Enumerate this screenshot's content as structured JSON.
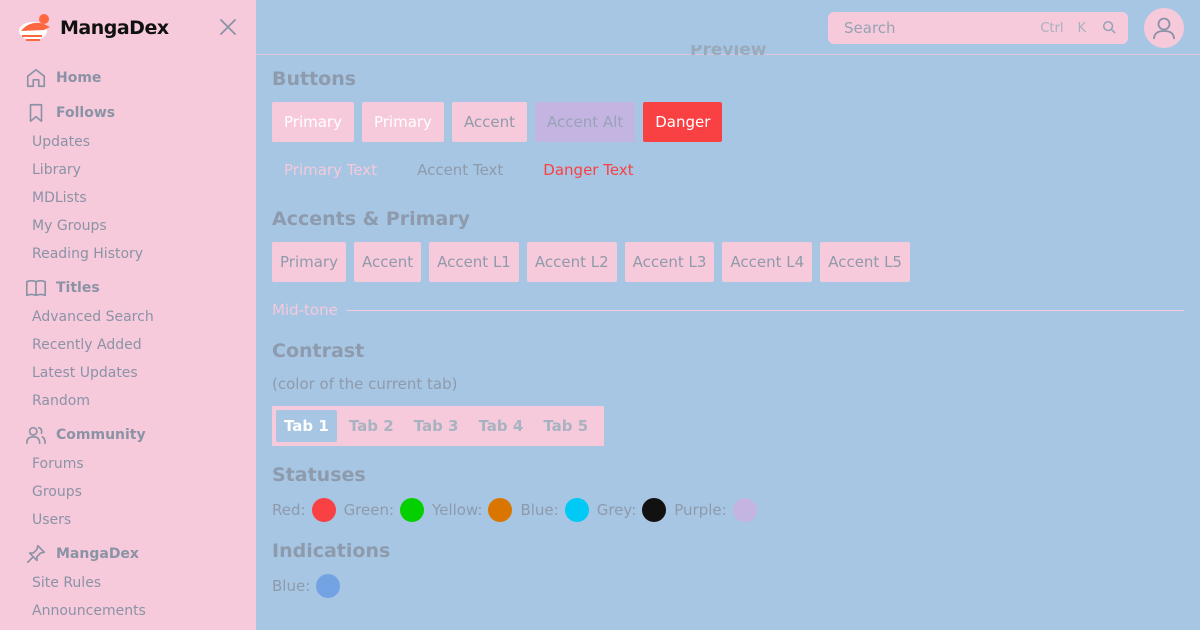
{
  "brand": {
    "name": "MangaDex"
  },
  "sidebar": {
    "sections": [
      {
        "label": "Home",
        "icon": "home-icon",
        "items": []
      },
      {
        "label": "Follows",
        "icon": "bookmark-icon",
        "items": [
          "Updates",
          "Library",
          "MDLists",
          "My Groups",
          "Reading History"
        ]
      },
      {
        "label": "Titles",
        "icon": "book-icon",
        "items": [
          "Advanced Search",
          "Recently Added",
          "Latest Updates",
          "Random"
        ]
      },
      {
        "label": "Community",
        "icon": "users-icon",
        "items": [
          "Forums",
          "Groups",
          "Users"
        ]
      },
      {
        "label": "MangaDex",
        "icon": "pin-icon",
        "items": [
          "Site Rules",
          "Announcements"
        ]
      }
    ]
  },
  "header": {
    "search_placeholder": "Search",
    "shortcut_ctrl": "Ctrl",
    "shortcut_key": "K"
  },
  "preview_title": "Preview",
  "buttons": {
    "heading": "Buttons",
    "filled": [
      "Primary",
      "Primary",
      "Accent",
      "Accent Alt",
      "Danger"
    ],
    "text": [
      "Primary Text",
      "Accent Text",
      "Danger Text"
    ]
  },
  "accents": {
    "heading": "Accents & Primary",
    "swatches": [
      "Primary",
      "Accent",
      "Accent L1",
      "Accent L2",
      "Accent L3",
      "Accent L4",
      "Accent L5"
    ]
  },
  "midtone": {
    "label": "Mid-tone"
  },
  "contrast": {
    "heading": "Contrast",
    "subtitle": "(color of the current tab)",
    "tabs": [
      "Tab 1",
      "Tab 2",
      "Tab 3",
      "Tab 4",
      "Tab 5"
    ],
    "active_tab": 0
  },
  "statuses": {
    "heading": "Statuses",
    "items": [
      {
        "label": "Red:",
        "color": "#f94144"
      },
      {
        "label": "Green:",
        "color": "#04d000"
      },
      {
        "label": "Yellow:",
        "color": "#da7500"
      },
      {
        "label": "Blue:",
        "color": "#00c9f5"
      },
      {
        "label": "Grey:",
        "color": "#111111"
      },
      {
        "label": "Purple:",
        "color": "#c4b4e2"
      }
    ]
  },
  "indications": {
    "heading": "Indications",
    "items": [
      {
        "label": "Blue:",
        "color": "#74a3e3"
      }
    ]
  },
  "colors": {
    "sidebar_bg": "#f7cadb",
    "main_bg": "#a6c6e4",
    "primary": "#f7cadb",
    "danger": "#f94144",
    "accent_alt": "#c4b4e2"
  }
}
